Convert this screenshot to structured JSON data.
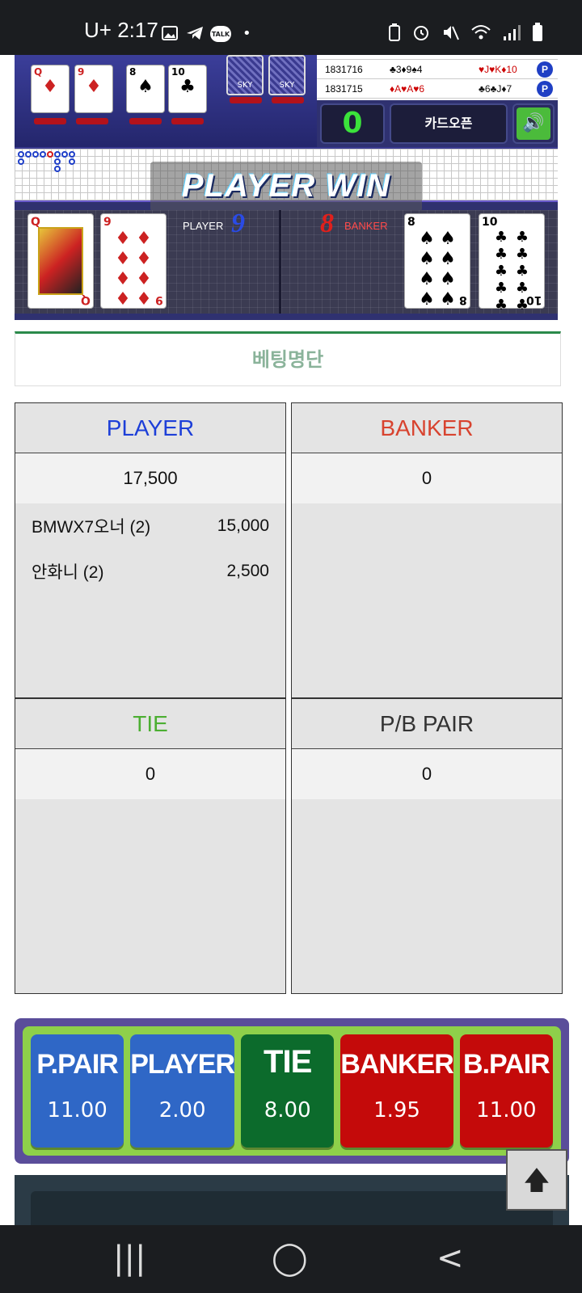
{
  "status_bar": {
    "time": "2:17",
    "carrier": "U+",
    "icons": [
      "gallery-icon",
      "telegram-icon",
      "talk-icon",
      "dot-icon",
      "battery-saver-icon",
      "alarm-icon",
      "mute-icon",
      "wifi-icon",
      "signal-icon",
      "battery-icon"
    ],
    "talk_label": "TALK"
  },
  "game": {
    "history": [
      {
        "id": "1831716",
        "player": "♣3♦9♠4",
        "banker": "♥J♥K♦10",
        "badge": "P"
      },
      {
        "id": "1831715",
        "player": "♦A♥A♥6",
        "banker": "♣6♣J♦7",
        "badge": "P"
      }
    ],
    "count": "0",
    "card_open_label": "카드오픈",
    "sky_label": "SKY",
    "win_banner": "PLAYER WIN",
    "player_label": "PLAYER",
    "player_score": "9",
    "banker_label": "BANKER",
    "banker_score": "8",
    "top_cards": [
      {
        "rank": "Q",
        "suit": "♦"
      },
      {
        "rank": "9",
        "suit": "♦"
      },
      {
        "rank": "8",
        "suit": "♠"
      },
      {
        "rank": "10",
        "suit": "♣"
      }
    ],
    "player_cards": [
      {
        "rank": "Q",
        "suit": "♦"
      },
      {
        "rank": "9",
        "suit": "♦"
      }
    ],
    "banker_cards": [
      {
        "rank": "8",
        "suit": "♠"
      },
      {
        "rank": "10",
        "suit": "♣"
      }
    ]
  },
  "bet_list_title": "베팅명단",
  "panels": {
    "player": {
      "title": "PLAYER",
      "total": "17,500",
      "entries": [
        {
          "name": "BMWX7오너 (2)",
          "amount": "15,000"
        },
        {
          "name": "안화니 (2)",
          "amount": "2,500"
        }
      ],
      "color": "#1d3fd8"
    },
    "banker": {
      "title": "BANKER",
      "total": "0",
      "color": "#d8432f"
    },
    "tie": {
      "title": "TIE",
      "total": "0",
      "color": "#4caf32"
    },
    "pair": {
      "title": "P/B PAIR",
      "total": "0",
      "color": "#333333"
    }
  },
  "bet_buttons": [
    {
      "name": "P.PAIR",
      "odds": "11.00",
      "color": "#2f67c6"
    },
    {
      "name": "PLAYER",
      "odds": "2.00",
      "color": "#2f67c6"
    },
    {
      "name": "TIE",
      "odds": "8.00",
      "color": "#0c6b2c"
    },
    {
      "name": "BANKER",
      "odds": "1.95",
      "color": "#c40a0a"
    },
    {
      "name": "B.PAIR",
      "odds": "11.00",
      "color": "#c40a0a"
    }
  ],
  "scroll_top_icon": "arrow-up-icon",
  "nav": {
    "recent": "|||",
    "home": "◯",
    "back": "<"
  }
}
